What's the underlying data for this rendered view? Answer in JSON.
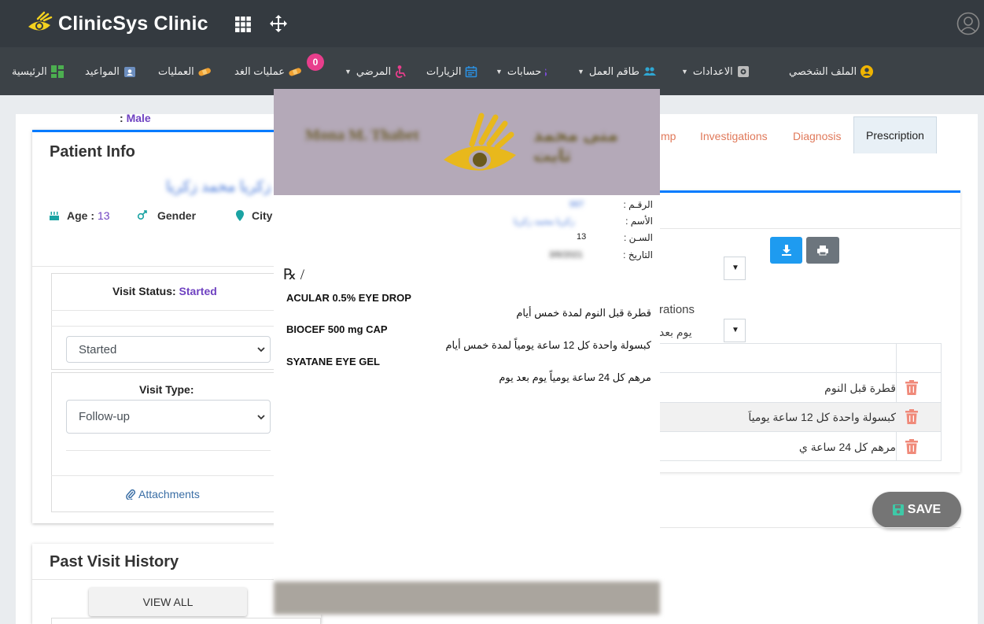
{
  "app": {
    "title": "ClinicSys Clinic"
  },
  "menu": {
    "items": [
      {
        "label": "الرئيسية",
        "icon": "dashboard-icon"
      },
      {
        "label": "المواعيد",
        "icon": "calendar-user-icon"
      },
      {
        "label": "العمليات",
        "icon": "bandage-icon"
      },
      {
        "label": "عمليات الغد",
        "icon": "bandage-icon",
        "badge": "0"
      },
      {
        "label": "المرضي",
        "icon": "wheelchair-icon"
      },
      {
        "label": "الزيارات",
        "icon": "calendar-icon"
      },
      {
        "label": "حسابات",
        "icon": "dollar-icon"
      },
      {
        "label": "طاقم العمل",
        "icon": "users-icon"
      },
      {
        "label": "الاعدادات",
        "icon": "gear-icon"
      },
      {
        "label": "الملف الشخصي",
        "icon": "user-circle-icon"
      }
    ]
  },
  "patient_info": {
    "title": "Patient Info",
    "name": "زكريا محمد زكريا",
    "age_label": "Age :",
    "age_value": "13",
    "gender_label": "Gender",
    "city_label": "City",
    "gender_value_prefix": ":",
    "gender_value": "Male"
  },
  "visit": {
    "status_label": "Visit Status:",
    "status_value": "Started",
    "status_select": "Started",
    "type_label": "Visit Type:",
    "type_select": "Follow-up",
    "attachments": "Attachments"
  },
  "past_visits": {
    "title": "Past Visit History",
    "view_all": "VIEW ALL"
  },
  "tabs": {
    "partial": "mp",
    "investigations": "Investigations",
    "diagnosis": "Diagnosis",
    "prescription": "Prescription"
  },
  "rx_panel": {
    "medications_label": "rations",
    "frequency_value": "يوم بعد",
    "rows": [
      "قطرة قبل النوم",
      "كبسولة واحدة كل 12 ساعة يومياً",
      "مرهم كل 24 ساعة ي"
    ],
    "save": "SAVE"
  },
  "rx_document": {
    "doctor_en": "Mona M. Thabet",
    "doctor_ar": "منى محمد ثابت",
    "fields": [
      {
        "label": "الرقـم :",
        "value": "997"
      },
      {
        "label": "الأسم :",
        "value": "زكريا محمد زكريا"
      },
      {
        "label": "السـن :",
        "value": "13"
      },
      {
        "label": "التاريخ :",
        "value": "3/6/2021"
      }
    ],
    "rx_symbol": "℞ /",
    "drugs": [
      {
        "name": "ACULAR 0.5% EYE DROP",
        "dose": "قطرة قبل النوم لمدة خمس أيام"
      },
      {
        "name": "BIOCEF 500 mg CAP",
        "dose": "كبسولة واحدة كل 12 ساعة يومياً لمدة خمس أيام"
      },
      {
        "name": "SYATANE EYE GEL",
        "dose": "مرهم كل 24 ساعة يومياً يوم بعد يوم"
      }
    ]
  },
  "colors": {
    "topbar": "#343a40",
    "accent": "#007bff",
    "tab_text": "#e0795a",
    "purple": "#6f42c1"
  }
}
